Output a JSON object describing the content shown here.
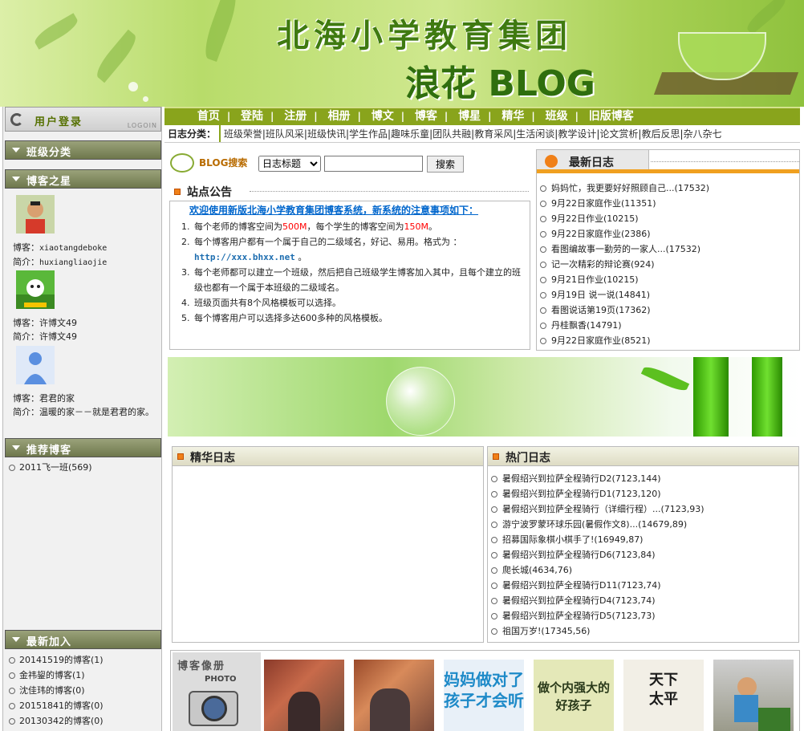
{
  "banner": {
    "title": "北海小学教育集团",
    "subtitle": "浪花 BLOG"
  },
  "login": {
    "label": "用户登录",
    "eng": "LOGOIN"
  },
  "sidebar": {
    "class_category": "班级分类",
    "star_bloggers_title": "博客之星",
    "bloggers": [
      {
        "blog_label": "博客：",
        "blog": "xiaotangdeboke",
        "intro_label": "简介：",
        "intro": "huxiangliaojie"
      },
      {
        "blog_label": "博客：",
        "blog": "许博文49",
        "intro_label": "简介：",
        "intro": "许博文49"
      },
      {
        "blog_label": "博客：",
        "blog": "君君的家",
        "intro_label": "简介：",
        "intro": "温暖的家－－就是君君的家。"
      }
    ],
    "recommend_title": "推荐博客",
    "recommend": [
      "2011飞一班(569)"
    ],
    "newest_title": "最新加入",
    "newest": [
      "20141519的博客(1)",
      "金祎鋆的博客(1)",
      "沈佳玮的博客(0)",
      "20151841的博客(0)",
      "20130342的博客(0)"
    ]
  },
  "nav": [
    "首页",
    "登陆",
    "注册",
    "相册",
    "博文",
    "博客",
    "博星",
    "精华",
    "班级",
    "旧版博客"
  ],
  "categories": {
    "label": "日志分类：",
    "items": [
      "班级荣誉",
      "班队风采",
      "班级快讯",
      "学生作品",
      "趣味乐童",
      "团队共融",
      "教育采风",
      "生活闲谈",
      "教学设计",
      "论文赏析",
      "教后反思",
      "杂八杂七"
    ]
  },
  "search": {
    "label": "BLOG搜索",
    "select_value": "日志标题",
    "button": "搜索"
  },
  "notice": {
    "title": "站点公告",
    "headline": "欢迎使用新版北海小学教育集团博客系统，新系统的注意事项如下：",
    "item1_a": "每个老师的博客空间为",
    "item1_b": "500M",
    "item1_c": "，每个学生的博客空间为",
    "item1_d": "150M",
    "item1_e": "。",
    "item2": "每个博客用户都有一个属于自己的二级域名，好记、易用。格式为 ：",
    "item2_link": "http://xxx.bhxx.net",
    "item2_end": " 。",
    "item3": "每个老师都可以建立一个班级，然后把自己班级学生博客加入其中，且每个建立的班级也都有一个属于本班级的二级域名。",
    "item4": "班级页面共有8个风格模板可以选择。",
    "item5": "每个博客用户可以选择多达600多种的风格模板。"
  },
  "latest": {
    "title": "最新日志",
    "items": [
      "妈妈忙，我更要好好照顾自己...(17532)",
      "9月22日家庭作业(11351)",
      "9月22日作业(10215)",
      "9月22日家庭作业(2386)",
      "看图编故事一勤劳的一家人...(17532)",
      "记一次精彩的辩论赛(924)",
      "9月21日作业(10215)",
      "9月19日 说一说(14841)",
      "看图说话第19页(17362)",
      "丹桂飘香(14791)",
      "9月22日家庭作业(8521)"
    ]
  },
  "featured": {
    "title": "精华日志"
  },
  "hot": {
    "title": "热门日志",
    "items": [
      "暑假绍兴到拉萨全程骑行D2(7123,144)",
      "暑假绍兴到拉萨全程骑行D1(7123,120)",
      "暑假绍兴到拉萨全程骑行（详细行程）...(7123,93)",
      "游宁波罗蒙环球乐园(暑假作文8)...(14679,89)",
      "招募国际象棋小棋手了!(16949,87)",
      "暑假绍兴到拉萨全程骑行D6(7123,84)",
      "爬长城(4634,76)",
      "暑假绍兴到拉萨全程骑行D11(7123,74)",
      "暑假绍兴到拉萨全程骑行D4(7123,74)",
      "暑假绍兴到拉萨全程骑行D5(7123,73)",
      "祖国万岁!(17345,56)"
    ]
  },
  "photos": {
    "title": "博客像册",
    "photo_label": "PHOTO",
    "thumb3_text": "妈妈做对了孩子才会听",
    "thumb4_text": "做个内强大的好孩子",
    "thumb5_text": "天下太平"
  }
}
